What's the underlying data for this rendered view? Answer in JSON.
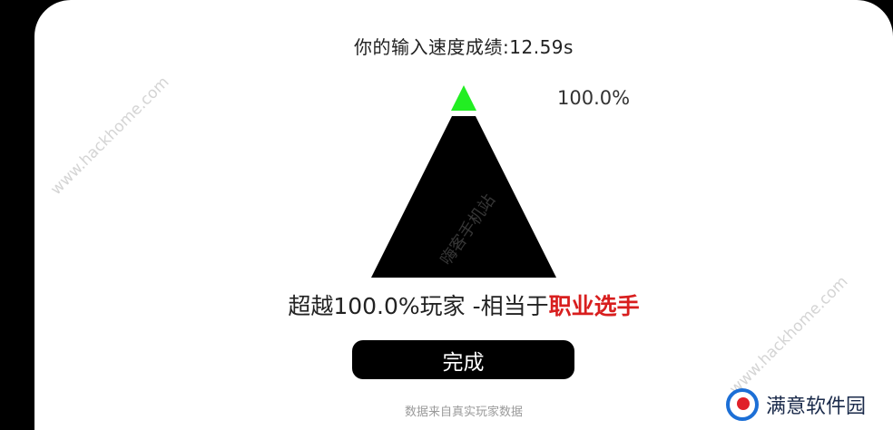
{
  "result": {
    "title": "你的输入速度成绩:12.59s",
    "percent_label": "100.0%",
    "percentile": 100.0,
    "summary_prefix": "超越100.0%玩家  -相当于",
    "summary_rank": "职业选手"
  },
  "actions": {
    "done_label": "完成"
  },
  "footnote": "数据来自真实玩家数据",
  "watermarks": {
    "site_left": "www.hackhome.com",
    "site_right": "www.hackhome.com",
    "center": "嗨客手机站"
  },
  "logo": {
    "text": "满意软件园"
  },
  "colors": {
    "background": "#000000",
    "card": "#ffffff",
    "pyramid_top": "#22ee22",
    "rank_text": "#d81e1e",
    "button": "#000000"
  }
}
